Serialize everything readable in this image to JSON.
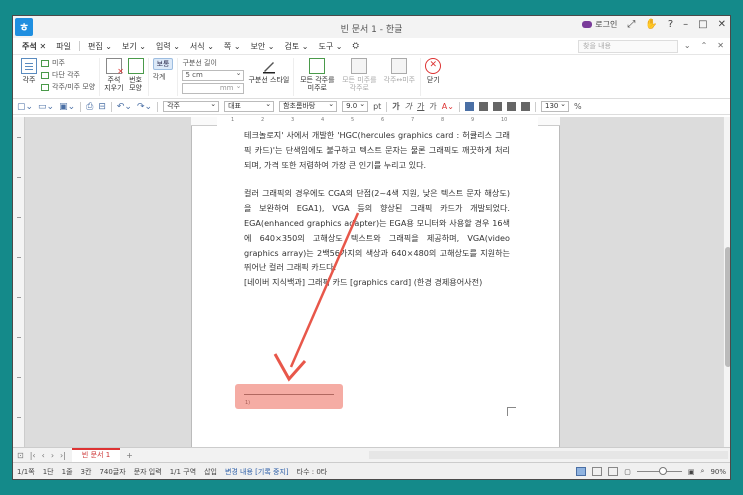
{
  "window": {
    "title": "빈 문서 1 - 한글",
    "login_label": "로그인",
    "controls": [
      "⤢",
      "✋",
      "?",
      "–",
      "□",
      "✕"
    ]
  },
  "menubar": {
    "items": [
      "주석",
      "파일",
      "편집",
      "보기",
      "입력",
      "서식",
      "쪽",
      "보안",
      "검토",
      "도구"
    ],
    "search_placeholder": "찾을 내용"
  },
  "ribbon": {
    "groups": [
      {
        "name": "각주",
        "items": [
          "각주"
        ],
        "small": [
          "미주",
          "다단 각주",
          "각주/미주 모양"
        ]
      },
      {
        "name": "지우기",
        "items": [
          "주석",
          "지우기"
        ],
        "small": [
          "번호",
          "모양"
        ]
      },
      {
        "name": "번호",
        "items": [
          "번호 모양"
        ],
        "small": [
          "보통",
          "각계"
        ]
      },
      {
        "name": "구분선",
        "label": "구분선 길이",
        "value": "5 cm",
        "unit": "mm",
        "items": [
          "구분선 스타일"
        ]
      },
      {
        "name": "모든",
        "items": [
          "모든 각주를 미주로",
          "모든 미주를 각주로",
          "각주↔미주"
        ]
      },
      {
        "name": "닫기",
        "items": [
          "닫기"
        ]
      }
    ]
  },
  "toolbar2": {
    "style": "각주",
    "font_group": "대표",
    "font": "함초롬바탕",
    "size": "9.0",
    "unit": "pt",
    "zoom": "130",
    "zoom_unit": "%",
    "char_styles": [
      "가",
      "가",
      "가",
      "가"
    ]
  },
  "document": {
    "paragraph1": "테크놀로지' 사에서 개발한 'HGC(hercules graphics card : 허큘리스 그래픽 카드)'는 단색임에도 불구하고 텍스트 문자는 물론 그래픽도 깨끗하게 처리되며, 가격 또한 저렴하여 가장 큰 인기를 누리고 있다.",
    "paragraph2": "컬러 그래픽의 경우에도 CGA의 단점(2~4색 지원, 낮은 텍스트 문자 해상도)을 보완하여 EGA1), VGA 등의 향상된 그래픽 카드가 개발되었다. EGA(enhanced graphics adapter)는 EGA용 모니터와 사용할 경우 16색에 640×350의 고해상도 텍스트와 그래픽을 제공하며, VGA(video graphics array)는 2백56가지의 색상과 640×480의 고해상도를 지원하는 뛰어난 컬러 그래픽 카드다.",
    "citation": "[네이버 지식백과] 그래픽 카드 [graphics card] (한경 경제용어사전)",
    "footnote_marker": "1)"
  },
  "tabs": {
    "doc_tab": "빈 문서 1",
    "add": "+"
  },
  "status": {
    "page": "1/1쪽",
    "section": "1단",
    "line": "1줄",
    "col": "3칸",
    "chars": "740글자",
    "input": "문자 입력",
    "section2": "1/1 구역",
    "insert": "삽입",
    "track": "변경 내용 [기록 중지]",
    "typing": "타수 : 0타",
    "zoom": "90%"
  },
  "colors": {
    "background": "#148a8a",
    "highlight": "#ee7468",
    "arrow": "#e8574a",
    "accent": "#2b5ea8"
  }
}
